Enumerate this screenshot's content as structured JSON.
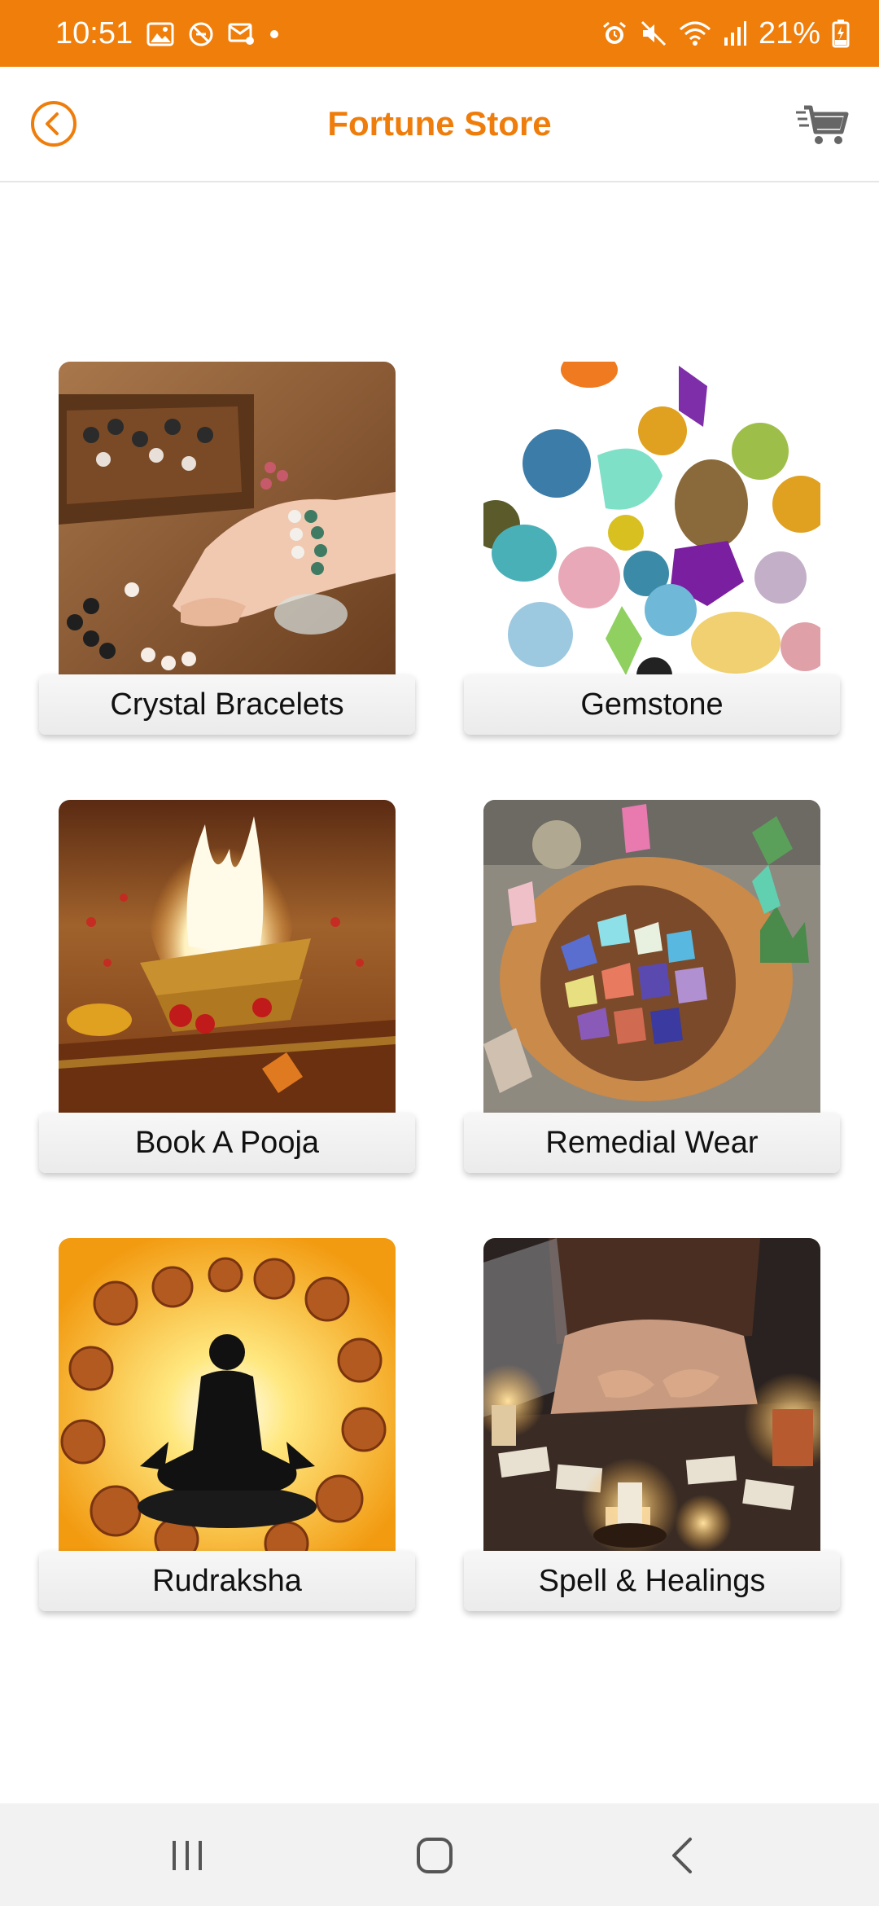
{
  "status_bar": {
    "time": "10:51",
    "battery": "21%",
    "left_icons": [
      "image-icon",
      "sync-off-icon",
      "mail-settings-icon",
      "dot-icon"
    ],
    "right_icons": [
      "alarm-icon",
      "mute-icon",
      "wifi-icon",
      "signal-icon",
      "battery-charging-icon"
    ],
    "bg_color": "#f07e0a"
  },
  "header": {
    "title": "Fortune Store",
    "back_icon": "back-circle-icon",
    "cart_icon": "cart-icon",
    "accent_color": "#ef7d0b"
  },
  "categories": [
    {
      "label": "Crystal Bracelets",
      "image": "crystal-bracelets-image"
    },
    {
      "label": "Gemstone",
      "image": "gemstone-image"
    },
    {
      "label": "Book A Pooja",
      "image": "pooja-fire-image"
    },
    {
      "label": "Remedial Wear",
      "image": "remedial-crystals-image"
    },
    {
      "label": "Rudraksha",
      "image": "rudraksha-meditation-image"
    },
    {
      "label": "Spell & Healings",
      "image": "spell-candles-image"
    }
  ],
  "nav_bar": {
    "buttons": [
      "recent-apps-icon",
      "home-icon",
      "back-icon"
    ]
  }
}
